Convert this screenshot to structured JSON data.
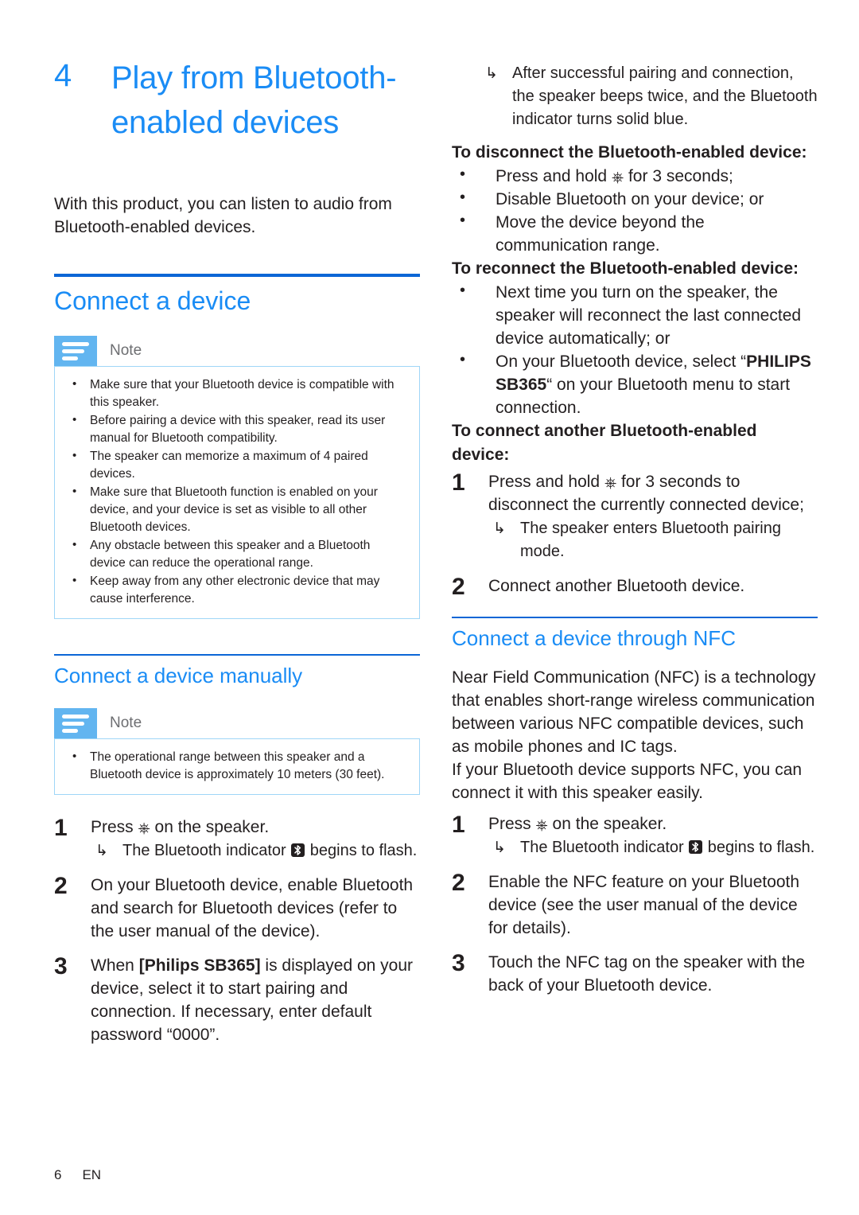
{
  "document": {
    "chapter_number": "4",
    "chapter_title": "Play from Bluetooth-enabled devices",
    "intro": "With this product, you can listen to audio from Bluetooth-enabled devices.",
    "footer_page": "6",
    "footer_language": "EN",
    "colors": {
      "heading_blue": "#1a8cf5",
      "rule_blue": "#0b66d6",
      "note_icon_blue": "#62b5f0",
      "note_border_blue": "#9fd6f7",
      "body_text": "#231f20",
      "note_label_gray": "#6d6e71"
    }
  },
  "left_column": {
    "section_connect": {
      "heading": "Connect a device",
      "note": {
        "label": "Note",
        "items": [
          "Make sure that your Bluetooth device is compatible with this speaker.",
          "Before pairing a device with this speaker, read its user manual for Bluetooth compatibility.",
          "The speaker can memorize a maximum of 4 paired devices.",
          "Make sure that Bluetooth function is enabled on your device, and your device is set as visible to all other Bluetooth devices.",
          "Any obstacle between this speaker and a Bluetooth device can reduce the operational range.",
          "Keep away from any other electronic device that may cause interference."
        ]
      }
    },
    "section_manual": {
      "heading": "Connect a device manually",
      "note": {
        "label": "Note",
        "items": [
          "The operational range between this speaker and a Bluetooth device is approximately 10 meters (30 feet)."
        ]
      },
      "steps": [
        {
          "number": "1",
          "text_before_icon": "Press ",
          "icon": "power-icon",
          "text_after_icon": " on the speaker.",
          "sub": {
            "arrow": "↳",
            "text_before_icon": "The Bluetooth indicator ",
            "icon": "bluetooth-icon",
            "text_after_icon": " begins to flash."
          }
        },
        {
          "number": "2",
          "text": "On your Bluetooth device, enable Bluetooth and search for Bluetooth devices (refer to the user manual of the device)."
        },
        {
          "number": "3",
          "text_part1": "When ",
          "bold": "[Philips SB365]",
          "text_part2": " is displayed on your device, select it to start pairing and connection. If necessary, enter default password “0000”."
        }
      ]
    }
  },
  "right_column": {
    "continued_sub": {
      "arrow": "↳",
      "text": "After successful pairing and connection, the speaker beeps twice, and the Bluetooth indicator turns solid blue."
    },
    "disconnect": {
      "lead": "To disconnect the Bluetooth-enabled device:",
      "items": [
        {
          "text_before_icon": "Press and hold ",
          "icon": "power-icon",
          "text_after_icon": " for 3 seconds;"
        },
        {
          "text": "Disable Bluetooth on your device; or"
        },
        {
          "text": "Move the device beyond the communication range."
        }
      ]
    },
    "reconnect": {
      "lead": "To reconnect the Bluetooth-enabled device:",
      "items": [
        {
          "text": "Next time you turn on the speaker, the speaker will reconnect the last connected device automatically; or"
        },
        {
          "text_part1": "On your Bluetooth device, select “",
          "bold": "PHILIPS SB365",
          "text_part2": "“ on your Bluetooth menu to start connection."
        }
      ]
    },
    "connect_another": {
      "lead": "To connect another Bluetooth-enabled device:",
      "steps": [
        {
          "number": "1",
          "text_before_icon": "Press and hold ",
          "icon": "power-icon",
          "text_after_icon": " for 3 seconds to disconnect the currently connected device;",
          "sub": {
            "arrow": "↳",
            "text": "The speaker enters Bluetooth pairing mode."
          }
        },
        {
          "number": "2",
          "text": "Connect another Bluetooth device."
        }
      ]
    },
    "section_nfc": {
      "heading": "Connect a device through NFC",
      "paragraph1": "Near Field Communication (NFC) is a technology that enables short-range wireless communication between various NFC compatible devices, such as mobile phones and IC tags.",
      "paragraph2": "If your Bluetooth device supports NFC, you can connect it with this speaker easily.",
      "steps": [
        {
          "number": "1",
          "text_before_icon": "Press ",
          "icon": "power-icon",
          "text_after_icon": " on the speaker.",
          "sub": {
            "arrow": "↳",
            "text_before_icon": "The Bluetooth indicator ",
            "icon": "bluetooth-icon",
            "text_after_icon": " begins to flash."
          }
        },
        {
          "number": "2",
          "text": "Enable the NFC feature on your Bluetooth device (see the user manual of the device for details)."
        },
        {
          "number": "3",
          "text": "Touch the NFC tag on the speaker with the back of your Bluetooth device."
        }
      ]
    }
  }
}
